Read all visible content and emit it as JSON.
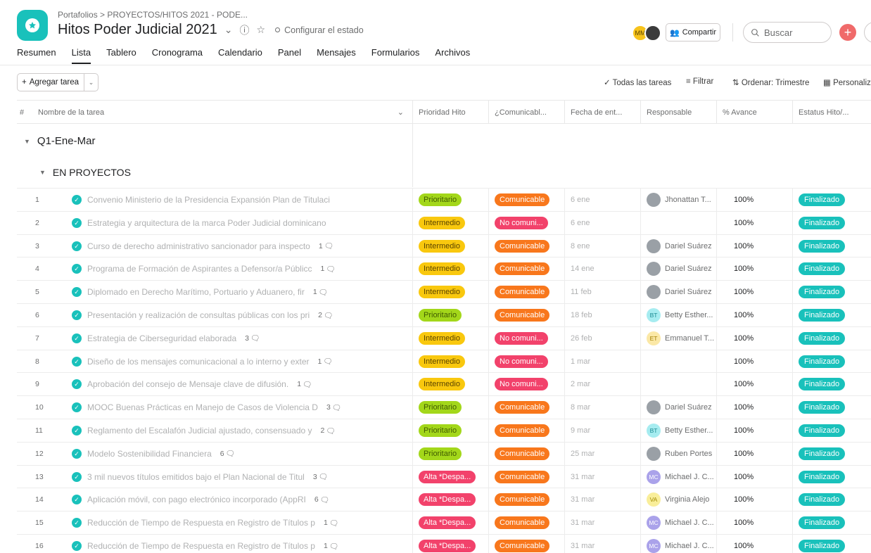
{
  "header": {
    "breadcrumb": "Portafolios  >  PROYECTOS/HITOS 2021 - PODE...",
    "title": "Hitos Poder Judicial 2021",
    "status_label": "Configurar el estado",
    "avatar_initials": "MM",
    "share_label": "Compartir",
    "search_placeholder": "Buscar"
  },
  "tabs": [
    "Resumen",
    "Lista",
    "Tablero",
    "Cronograma",
    "Calendario",
    "Panel",
    "Mensajes",
    "Formularios",
    "Archivos"
  ],
  "active_tab": "Lista",
  "toolbar": {
    "add_task": "Agregar tarea",
    "all_tasks": "Todas las tareas",
    "filter": "Filtrar",
    "sort": "Ordenar: Trimestre",
    "customize": "Personaliza"
  },
  "columns": {
    "num": "#",
    "name": "Nombre de la tarea",
    "priority": "Prioridad Hito",
    "communicable": "¿Comunicabl...",
    "date": "Fecha de ent...",
    "assignee": "Responsable",
    "progress": "% Avance",
    "status": "Estatus Hito/..."
  },
  "sections": {
    "quarter": "Q1-Ene-Mar",
    "group": "EN PROYECTOS"
  },
  "colors": {
    "teal": "#19c1bb",
    "prioritario": "#a3d71a",
    "intermedio": "#f9c80e",
    "alta": "#f2426b",
    "comunicable": "#f8771c",
    "no_comunicable": "#f2426b"
  },
  "rows": [
    {
      "num": "1",
      "name": "Convenio Ministerio de la Presidencia Expansión Plan de Titulaci",
      "comments": "",
      "priority": "Prioritario",
      "pkind": "prioritario",
      "comm": "Comunicable",
      "ckind": "comunicable",
      "date": "6 ene",
      "assignee": "Jhonattan T...",
      "akind": "photo",
      "initials": "",
      "progress": "100%",
      "status": "Finalizado"
    },
    {
      "num": "2",
      "name": "Estrategia y arquitectura de la marca Poder Judicial dominicano",
      "comments": "",
      "priority": "Intermedio",
      "pkind": "intermedio",
      "comm": "No comuni...",
      "ckind": "no",
      "date": "6 ene",
      "assignee": "",
      "akind": "none",
      "initials": "",
      "progress": "100%",
      "status": "Finalizado"
    },
    {
      "num": "3",
      "name": "Curso de derecho administrativo sancionador para inspecto",
      "comments": "1",
      "priority": "Intermedio",
      "pkind": "intermedio",
      "comm": "Comunicable",
      "ckind": "comunicable",
      "date": "8 ene",
      "assignee": "Dariel Suárez",
      "akind": "photo",
      "initials": "",
      "progress": "100%",
      "status": "Finalizado"
    },
    {
      "num": "4",
      "name": "Programa de Formación de Aspirantes a Defensor/a Públicc",
      "comments": "1",
      "priority": "Intermedio",
      "pkind": "intermedio",
      "comm": "Comunicable",
      "ckind": "comunicable",
      "date": "14 ene",
      "assignee": "Dariel Suárez",
      "akind": "photo",
      "initials": "",
      "progress": "100%",
      "status": "Finalizado"
    },
    {
      "num": "5",
      "name": "Diplomado en Derecho Marítimo, Portuario y Aduanero, fir",
      "comments": "1",
      "priority": "Intermedio",
      "pkind": "intermedio",
      "comm": "Comunicable",
      "ckind": "comunicable",
      "date": "11 feb",
      "assignee": "Dariel Suárez",
      "akind": "photo",
      "initials": "",
      "progress": "100%",
      "status": "Finalizado"
    },
    {
      "num": "6",
      "name": "Presentación y realización de consultas públicas con los pri",
      "comments": "2",
      "priority": "Prioritario",
      "pkind": "prioritario",
      "comm": "Comunicable",
      "ckind": "comunicable",
      "date": "18 feb",
      "assignee": "Betty Esther...",
      "akind": "bt",
      "initials": "BT",
      "progress": "100%",
      "status": "Finalizado"
    },
    {
      "num": "7",
      "name": "Estrategia de Ciberseguridad elaborada",
      "comments": "3",
      "priority": "Intermedio",
      "pkind": "intermedio",
      "comm": "No comuni...",
      "ckind": "no",
      "date": "26 feb",
      "assignee": "Emmanuel T...",
      "akind": "et",
      "initials": "ET",
      "progress": "100%",
      "status": "Finalizado"
    },
    {
      "num": "8",
      "name": "Diseño de los mensajes comunicacional a lo interno y exter",
      "comments": "1",
      "priority": "Intermedio",
      "pkind": "intermedio",
      "comm": "No comuni...",
      "ckind": "no",
      "date": "1 mar",
      "assignee": "",
      "akind": "none",
      "initials": "",
      "progress": "100%",
      "status": "Finalizado"
    },
    {
      "num": "9",
      "name": "Aprobación del consejo de Mensaje clave de difusión.",
      "comments": "1",
      "priority": "Intermedio",
      "pkind": "intermedio",
      "comm": "No comuni...",
      "ckind": "no",
      "date": "2 mar",
      "assignee": "",
      "akind": "none",
      "initials": "",
      "progress": "100%",
      "status": "Finalizado"
    },
    {
      "num": "10",
      "name": "MOOC Buenas Prácticas en Manejo de Casos de Violencia D",
      "comments": "3",
      "priority": "Prioritario",
      "pkind": "prioritario",
      "comm": "Comunicable",
      "ckind": "comunicable",
      "date": "8 mar",
      "assignee": "Dariel Suárez",
      "akind": "photo",
      "initials": "",
      "progress": "100%",
      "status": "Finalizado"
    },
    {
      "num": "11",
      "name": "Reglamento del Escalafón Judicial ajustado, consensuado y",
      "comments": "2",
      "priority": "Prioritario",
      "pkind": "prioritario",
      "comm": "Comunicable",
      "ckind": "comunicable",
      "date": "9 mar",
      "assignee": "Betty Esther...",
      "akind": "bt",
      "initials": "BT",
      "progress": "100%",
      "status": "Finalizado"
    },
    {
      "num": "12",
      "name": "Modelo Sostenibilidad Financiera",
      "comments": "6",
      "priority": "Prioritario",
      "pkind": "prioritario",
      "comm": "Comunicable",
      "ckind": "comunicable",
      "date": "25 mar",
      "assignee": "Ruben Portes",
      "akind": "photo",
      "initials": "",
      "progress": "100%",
      "status": "Finalizado"
    },
    {
      "num": "13",
      "name": " 3 mil nuevos títulos emitidos bajo el Plan Nacional de Titul",
      "comments": "3",
      "priority": "Alta *Despa...",
      "pkind": "alta",
      "comm": "Comunicable",
      "ckind": "comunicable",
      "date": "31 mar",
      "assignee": "Michael J. C...",
      "akind": "mc",
      "initials": "MC",
      "progress": "100%",
      "status": "Finalizado"
    },
    {
      "num": "14",
      "name": "Aplicación móvil, con pago electrónico incorporado (AppRI",
      "comments": "6",
      "priority": "Alta *Despa...",
      "pkind": "alta",
      "comm": "Comunicable",
      "ckind": "comunicable",
      "date": "31 mar",
      "assignee": "Virginia Alejo",
      "akind": "va",
      "initials": "VA",
      "progress": "100%",
      "status": "Finalizado"
    },
    {
      "num": "15",
      "name": "Reducción de Tiempo de Respuesta en Registro de Títulos p",
      "comments": "1",
      "priority": "Alta *Despa...",
      "pkind": "alta",
      "comm": "Comunicable",
      "ckind": "comunicable",
      "date": "31 mar",
      "assignee": "Michael J. C...",
      "akind": "mc",
      "initials": "MC",
      "progress": "100%",
      "status": "Finalizado"
    },
    {
      "num": "16",
      "name": "Reducción de Tiempo de Respuesta en Registro de Títulos p",
      "comments": "1",
      "priority": "Alta *Despa...",
      "pkind": "alta",
      "comm": "Comunicable",
      "ckind": "comunicable",
      "date": "31 mar",
      "assignee": "Michael J. C...",
      "akind": "mc",
      "initials": "MC",
      "progress": "100%",
      "status": "Finalizado"
    }
  ]
}
